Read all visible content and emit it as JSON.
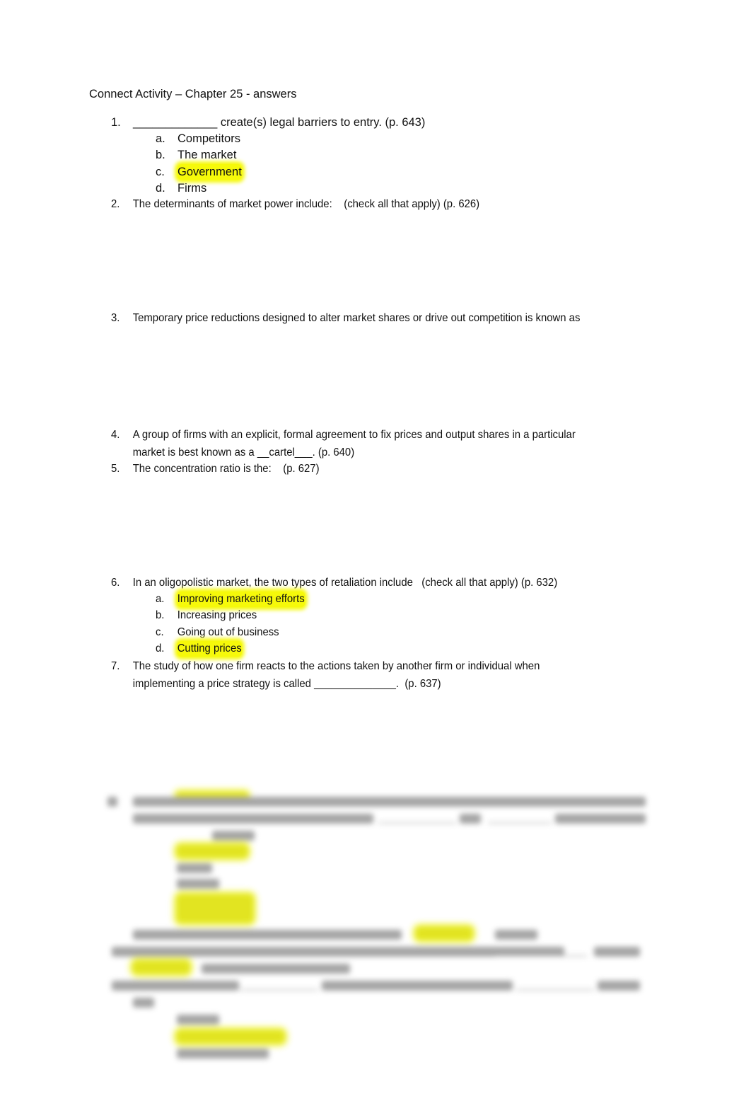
{
  "document": {
    "title": "Connect Activity – Chapter 25 - answers",
    "highlight_color": "#f6f90a",
    "questions": [
      {
        "number": "1.",
        "text": "_____________ create(s) legal barriers to entry. (p. 643)",
        "options": [
          {
            "letter": "a.",
            "text": "Competitors",
            "highlighted": false
          },
          {
            "letter": "b.",
            "text": "The market",
            "highlighted": false
          },
          {
            "letter": "c.",
            "text": "Government",
            "highlighted": true
          },
          {
            "letter": "d.",
            "text": "Firms",
            "highlighted": false
          }
        ]
      },
      {
        "number": "2.",
        "text": "The determinants of market power include:    (check all that apply) (p. 626)"
      },
      {
        "number": "3.",
        "text": "Temporary price reductions designed to alter market shares or drive out competition is known as"
      },
      {
        "number": "4.",
        "text_line1": "A group of firms with an explicit, formal agreement to fix prices and output shares in a particular",
        "text_line2": "market is best known as a __cartel___. (p. 640)"
      },
      {
        "number": "5.",
        "text": "The concentration ratio is the:    (p. 627)"
      },
      {
        "number": "6.",
        "text": "In an oligopolistic market, the two types of retaliation include   (check all that apply) (p. 632)",
        "options": [
          {
            "letter": "a.",
            "text": "Improving marketing efforts",
            "highlighted": true
          },
          {
            "letter": "b.",
            "text": "Increasing prices",
            "highlighted": false
          },
          {
            "letter": "c.",
            "text": "Going out of business",
            "highlighted": false
          },
          {
            "letter": "d.",
            "text": "Cutting prices",
            "highlighted": true
          }
        ]
      },
      {
        "number": "7.",
        "text_line1": "The study of how one firm reacts to the actions taken by another firm or individual when",
        "text_line2": "implementing a price strategy is called ______________.  (p. 637)"
      }
    ],
    "blurred_section_note": "Questions 8–11 obscured (blurred)"
  }
}
